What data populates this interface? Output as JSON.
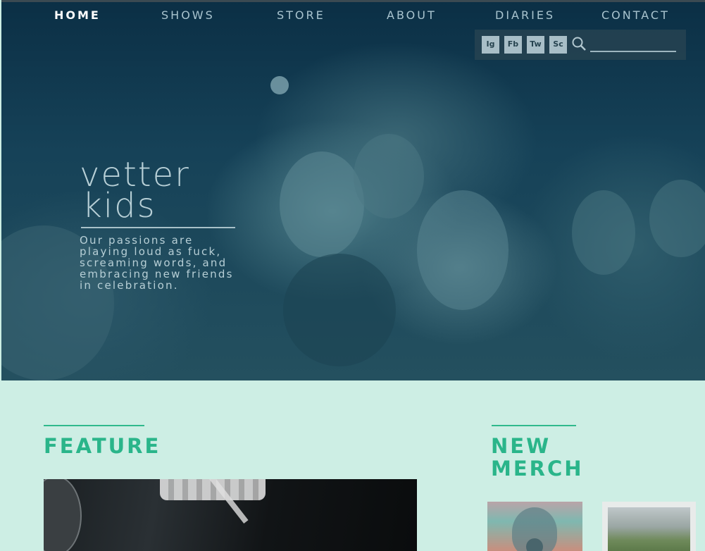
{
  "nav": {
    "items": [
      {
        "label": "HOME",
        "active": true
      },
      {
        "label": "SHOWS",
        "active": false
      },
      {
        "label": "STORE",
        "active": false
      },
      {
        "label": "ABOUT",
        "active": false
      },
      {
        "label": "DIARIES",
        "active": false
      },
      {
        "label": "CONTACT",
        "active": false
      }
    ]
  },
  "social": {
    "buttons": [
      "Ig",
      "Fb",
      "Tw",
      "Sc"
    ],
    "search_placeholder": ""
  },
  "hero": {
    "logo_line1": "vetter",
    "logo_line2": "kids",
    "tagline": "Our passions are playing loud as fuck, screaming words, and embracing new friends in celebration."
  },
  "feature": {
    "title": "FEATURE"
  },
  "merch": {
    "title_line1": "NEW",
    "title_line2": "MERCH"
  },
  "colors": {
    "accent": "#2ab58a",
    "background": "#cdeee4",
    "hero_overlay": "#0b2f45"
  }
}
